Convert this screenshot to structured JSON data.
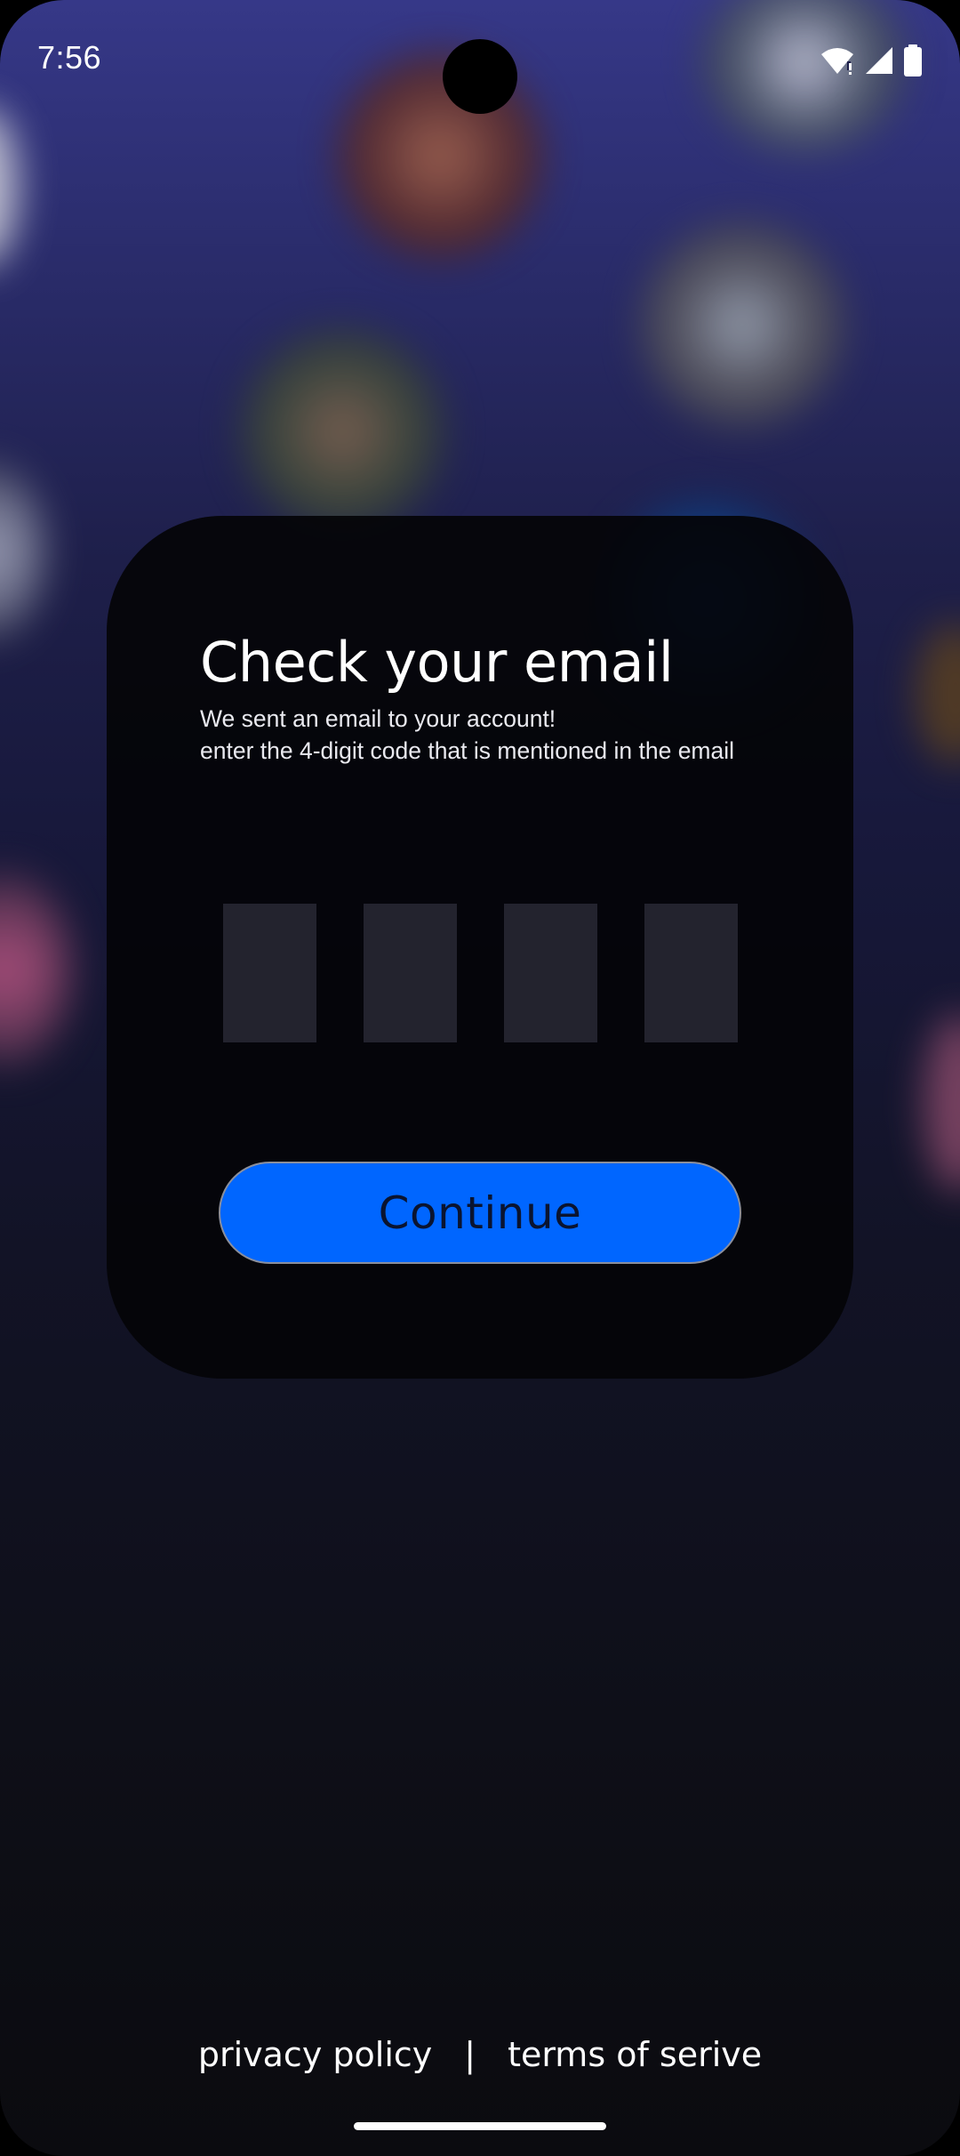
{
  "status_bar": {
    "time": "7:56",
    "icons": [
      "wifi-icon",
      "signal-icon",
      "battery-icon"
    ]
  },
  "card": {
    "title": "Check your email",
    "subtitle_line1": "We sent an email to your account!",
    "subtitle_line2": "enter the 4-digit code that is mentioned in the email",
    "code_digits": [
      "",
      "",
      "",
      ""
    ],
    "continue_label": "Continue"
  },
  "footer": {
    "privacy_label": "privacy policy",
    "separator": "|",
    "terms_label": "terms of serive"
  },
  "colors": {
    "accent": "#0066ff",
    "code_box": "#23232e",
    "card_bg": "#040408"
  }
}
